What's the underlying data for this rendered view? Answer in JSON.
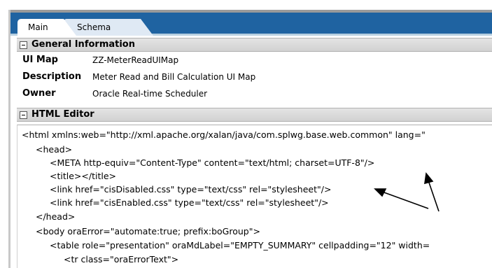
{
  "tabs": [
    {
      "label": "Main",
      "active": true
    },
    {
      "label": "Schema",
      "active": false
    }
  ],
  "general_section": {
    "title": "General Information",
    "fields": [
      {
        "label": "UI Map",
        "value": "ZZ-MeterReadUIMap"
      },
      {
        "label": "Description",
        "value": "Meter Read and Bill Calculation UI Map"
      },
      {
        "label": "Owner",
        "value": "Oracle Real-time Scheduler"
      }
    ]
  },
  "editor_section": {
    "title": "HTML Editor",
    "lines": [
      "<html xmlns:web=\"http://xml.apache.org/xalan/java/com.splwg.base.web.common\" lang=\"",
      "<head>",
      "<META http-equiv=\"Content-Type\" content=\"text/html; charset=UTF-8\"/>",
      "<title></title>",
      "<link href=\"cisDisabled.css\" type=\"text/css\" rel=\"stylesheet\"/>",
      "<link href=\"cisEnabled.css\" type=\"text/css\" rel=\"stylesheet\"/>",
      "</head>",
      "<body oraError=\"automate:true; prefix:boGroup\">",
      "<table role=\"presentation\" oraMdLabel=\"EMPTY_SUMMARY\" cellpadding=\"12\" width=",
      "<tr class=\"oraErrorText\">"
    ]
  },
  "colors": {
    "tab_bar": "#1f63a1",
    "section_header": "#d8d8d8"
  }
}
